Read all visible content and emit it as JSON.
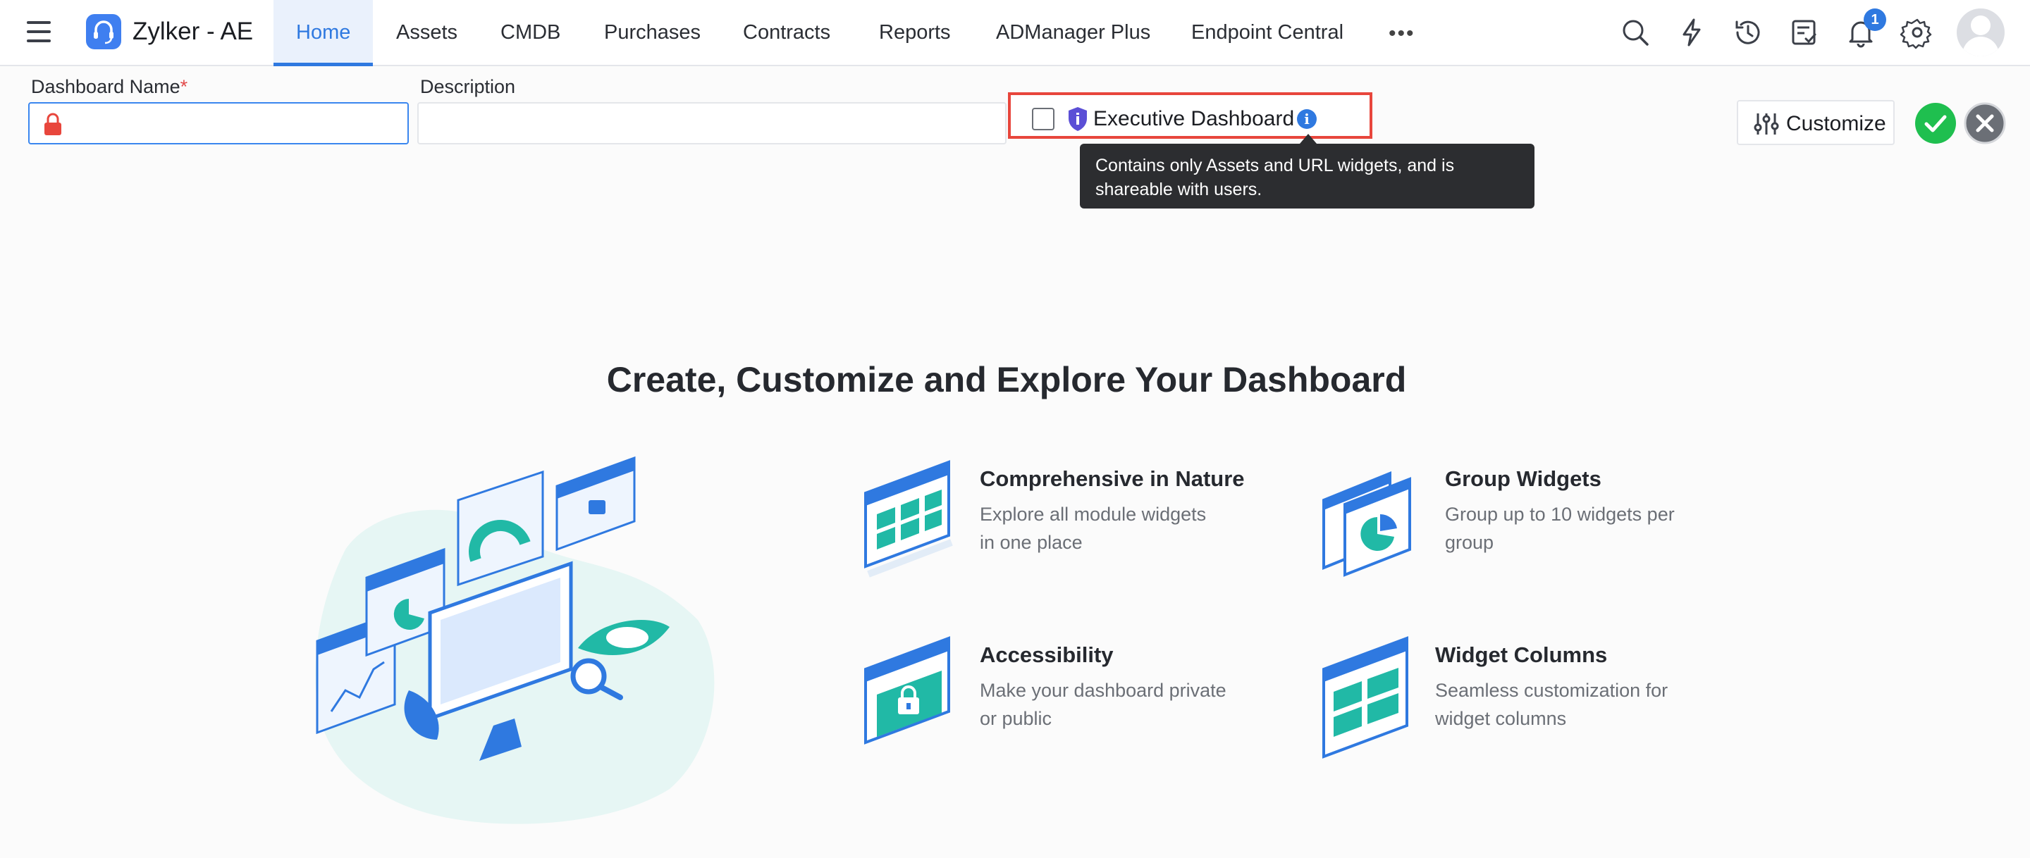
{
  "app": {
    "name": "Zylker - AE"
  },
  "nav": {
    "tabs": [
      {
        "label": "Home",
        "active": true
      },
      {
        "label": "Assets"
      },
      {
        "label": "CMDB"
      },
      {
        "label": "Purchases"
      },
      {
        "label": "Contracts"
      },
      {
        "label": "Reports"
      },
      {
        "label": "ADManager Plus"
      },
      {
        "label": "Endpoint Central"
      }
    ],
    "more": "•••",
    "notification_count": "1",
    "icons": [
      "search-icon",
      "lightning-icon",
      "history-icon",
      "tasks-icon",
      "bell-icon",
      "gear-icon",
      "avatar"
    ]
  },
  "form": {
    "name_label": "Dashboard Name",
    "required_mark": "*",
    "name_value": "",
    "description_label": "Description",
    "description_value": "",
    "executive_label": "Executive Dashboard",
    "executive_checked": false,
    "info_glyph": "i",
    "tooltip": "Contains only Assets and URL widgets, and is shareable with users.",
    "customize_label": "Customize"
  },
  "hero": {
    "title": "Create, Customize and Explore Your Dashboard",
    "features": [
      {
        "title": "Comprehensive in Nature",
        "desc_line1": "Explore all module widgets",
        "desc_line2": "in one place"
      },
      {
        "title": "Group Widgets",
        "desc_line1": "Group up to 10 widgets per",
        "desc_line2": "group"
      },
      {
        "title": "Accessibility",
        "desc_line1": "Make your dashboard private",
        "desc_line2": "or public"
      },
      {
        "title": "Widget Columns",
        "desc_line1": "Seamless customization for",
        "desc_line2": "widget columns"
      }
    ]
  },
  "colors": {
    "accent": "#2f79e0",
    "highlight_border": "#e8463c",
    "confirm": "#1fbf4f",
    "cancel": "#6b6f76",
    "teal": "#21b9a6"
  }
}
